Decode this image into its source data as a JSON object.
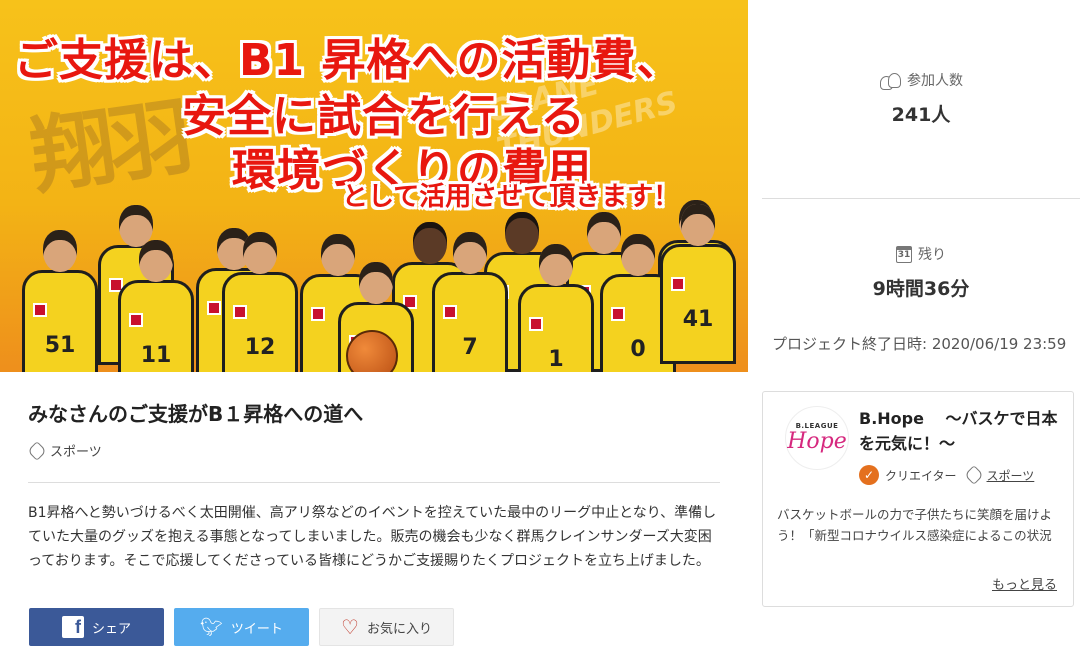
{
  "hero": {
    "headline_line1": "ご支援は、B1 昇格への活動費、",
    "headline_line2": "安全に試合を行える",
    "headline_line3": "環境づくりの費用",
    "headline_line4": "として活用させて頂きます！",
    "players": [
      {
        "number": "51"
      },
      {
        "number": "11"
      },
      {
        "number": "12"
      },
      {
        "number": "7"
      },
      {
        "number": "1"
      },
      {
        "number": "0"
      },
      {
        "number": "41"
      }
    ],
    "colors": {
      "accent_red": "#e8170f",
      "jersey_yellow": "#f4d21f",
      "background": "#f7c21a"
    }
  },
  "stats": {
    "participants_label": "参加人数",
    "participants_value": "241人",
    "remaining_label": "残り",
    "remaining_value": "9時間36分",
    "end_date": "プロジェクト終了日時: 2020/06/19 23:59",
    "calendar_icon_text": "31"
  },
  "project": {
    "title": "みなさんのご支援がB１昇格への道へ",
    "category": "スポーツ",
    "description": "B1昇格へと勢いづけるべく太田開催、高アリ祭などのイベントを控えていた最中のリーグ中止となり、準備していた大量のグッズを抱える事態となってしまいました。販売の機会も少なく群馬クレインサンダーズ大変困っております。そこで応援してくださっている皆様にどうかご支援賜りたくプロジェクトを立ち上げました。"
  },
  "actions": {
    "share_label": "シェア",
    "tweet_label": "ツイート",
    "favorite_label": "お気に入り"
  },
  "creator": {
    "avatar_top": "B.LEAGUE",
    "avatar_main": "Hope",
    "name": "B.Hope　 ～バスケで日本を元気に！～",
    "role_label": "クリエイター",
    "category": "スポーツ",
    "description": "バスケットボールの力で子供たちに笑顔を届けよう！「新型コロナウイルス感染症によるこの状況",
    "more_label": "もっと見る"
  }
}
